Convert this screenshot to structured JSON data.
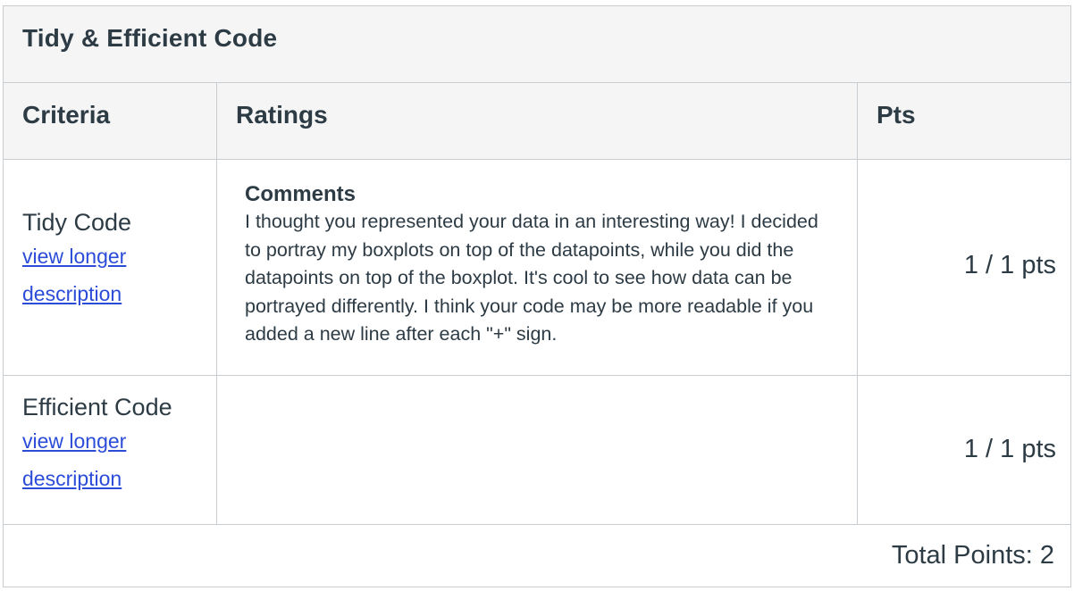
{
  "rubric": {
    "title": "Tidy & Efficient Code",
    "headers": {
      "criteria": "Criteria",
      "ratings": "Ratings",
      "pts": "Pts"
    },
    "rows": [
      {
        "criterion": "Tidy Code",
        "link_text": "view longer description",
        "comments_label": "Comments",
        "comments": "I thought you represented your data in an interesting way! I decided to portray my boxplots on top of the datapoints, while you did the datapoints on top of the boxplot. It's cool to see how data can be portrayed differently. I think your code may be more readable if you added a new line after each \"+\" sign.",
        "points": "1 / 1 pts"
      },
      {
        "criterion": "Efficient Code",
        "link_text": "view longer description",
        "points": "1 / 1 pts"
      }
    ],
    "total": "Total Points: 2"
  }
}
